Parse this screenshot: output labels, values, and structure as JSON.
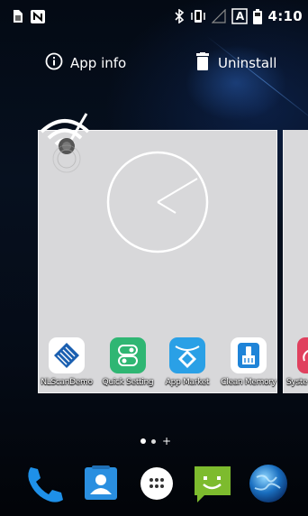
{
  "status_bar": {
    "time": "4:10",
    "left_icons": [
      "sim-icon",
      "nfc-icon"
    ],
    "right_icons": [
      "bluetooth-icon",
      "vibrate-icon",
      "signal-icon",
      "keyboard-a-icon",
      "battery-icon"
    ],
    "keyboard_letter": "A"
  },
  "app_info_bar": {
    "app_info_label": "App info",
    "uninstall_label": "Uninstall"
  },
  "home_preview": {
    "apps": [
      {
        "label": "NLScanDemo",
        "icon": "nlscan-icon"
      },
      {
        "label": "Quick Setting",
        "icon": "quick-setting-icon"
      },
      {
        "label": "App Market",
        "icon": "app-market-icon"
      },
      {
        "label": "Clean Memory",
        "icon": "clean-memory-icon"
      },
      {
        "label": "Syste",
        "icon": "system-icon"
      }
    ]
  },
  "page_indicator": {
    "plus": "+"
  },
  "dock": [
    "phone-icon",
    "contacts-icon",
    "all-apps-icon",
    "messaging-icon",
    "browser-globe-icon"
  ],
  "colors": {
    "quick_setting": "#2fb673",
    "app_market": "#2aa0e6",
    "clean_memory": "#1f84d8",
    "system": "#e0405e",
    "phone": "#1e90e8",
    "messaging": "#7dbb2e"
  }
}
